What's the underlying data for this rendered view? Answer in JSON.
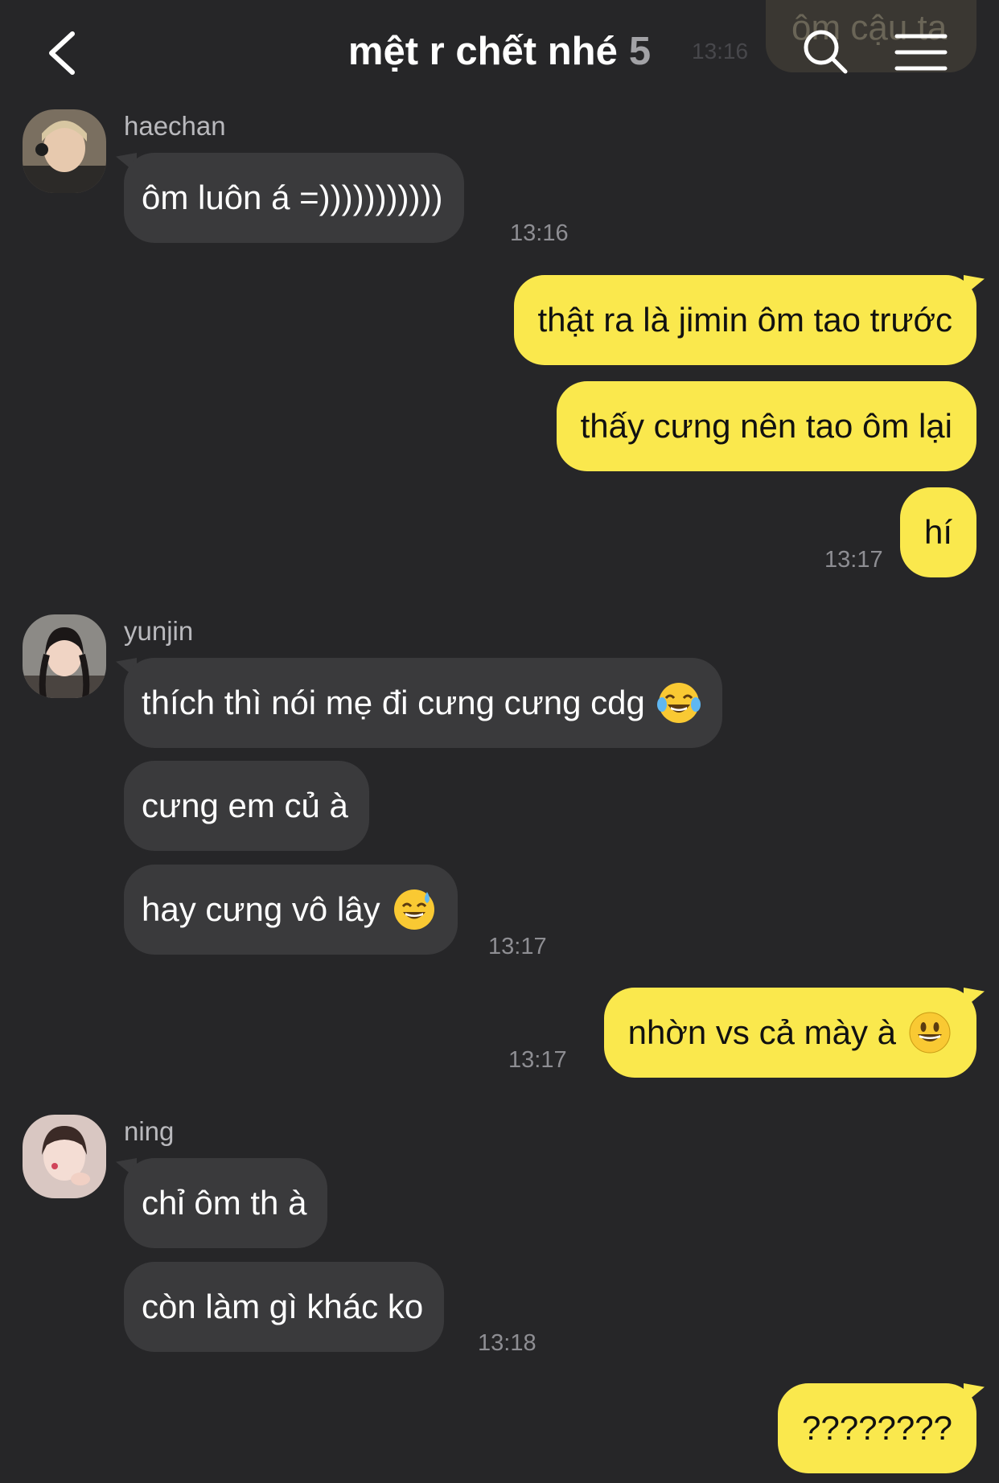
{
  "header": {
    "title": "mệt r chết nhé",
    "member_count": "5",
    "ghost_bubble_text": "ôm cậu ta",
    "ghost_time": "13:16",
    "icons": [
      "chevron-left-icon",
      "search-icon",
      "menu-icon"
    ]
  },
  "colors": {
    "background": "#262628",
    "incoming_bubble": "#3a3a3c",
    "outgoing_bubble": "#fae84d",
    "timestamp": "#8e8e93"
  },
  "messages": [
    {
      "sender": "haechan",
      "direction": "in",
      "text": "ôm luôn á =)))))))))))",
      "time": "13:16"
    },
    {
      "direction": "out",
      "text": "thật ra là jimin ôm tao trước"
    },
    {
      "direction": "out",
      "text": "thấy cưng nên tao ôm lại"
    },
    {
      "direction": "out",
      "text": "hí",
      "time": "13:17"
    },
    {
      "sender": "yunjin",
      "direction": "in",
      "text": "thích thì nói mẹ đi cưng cưng cdg",
      "emoji": "😂"
    },
    {
      "sender": "yunjin",
      "direction": "in",
      "text": "cưng em củ à"
    },
    {
      "sender": "yunjin",
      "direction": "in",
      "text": "hay cưng vô lây",
      "emoji": "😅",
      "time": "13:17"
    },
    {
      "direction": "out",
      "text": "nhờn vs cả mày à",
      "emoji": "😀",
      "time": "13:17"
    },
    {
      "sender": "ning",
      "direction": "in",
      "text": "chỉ ôm th à"
    },
    {
      "sender": "ning",
      "direction": "in",
      "text": "còn làm gì khác ko",
      "time": "13:18"
    },
    {
      "direction": "out",
      "text": "????????"
    }
  ]
}
